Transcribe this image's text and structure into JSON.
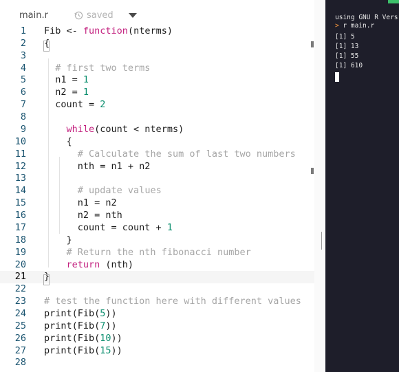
{
  "tab": {
    "filename": "main.r",
    "status": "saved"
  },
  "editor": {
    "current_line": 21,
    "lines": [
      {
        "n": "1",
        "tokens": [
          {
            "t": "Fib <- "
          },
          {
            "t": "function",
            "c": "kw"
          },
          {
            "t": "(nterms)"
          }
        ]
      },
      {
        "n": "2",
        "tokens": [
          {
            "t": "{"
          }
        ]
      },
      {
        "n": "3",
        "tokens": []
      },
      {
        "n": "4",
        "tokens": [
          {
            "t": "  "
          },
          {
            "t": "# first two terms",
            "c": "cm"
          }
        ]
      },
      {
        "n": "5",
        "tokens": [
          {
            "t": "  n1 = "
          },
          {
            "t": "1",
            "c": "num"
          }
        ]
      },
      {
        "n": "6",
        "tokens": [
          {
            "t": "  n2 = "
          },
          {
            "t": "1",
            "c": "num"
          }
        ]
      },
      {
        "n": "7",
        "tokens": [
          {
            "t": "  count = "
          },
          {
            "t": "2",
            "c": "num"
          }
        ]
      },
      {
        "n": "8",
        "tokens": []
      },
      {
        "n": "9",
        "tokens": [
          {
            "t": "    "
          },
          {
            "t": "while",
            "c": "kw"
          },
          {
            "t": "(count < nterms)"
          }
        ]
      },
      {
        "n": "10",
        "tokens": [
          {
            "t": "    {"
          }
        ]
      },
      {
        "n": "11",
        "tokens": [
          {
            "t": "      "
          },
          {
            "t": "# Calculate the sum of last two numbers",
            "c": "cm"
          }
        ]
      },
      {
        "n": "12",
        "tokens": [
          {
            "t": "      nth = n1 + n2"
          }
        ]
      },
      {
        "n": "13",
        "tokens": []
      },
      {
        "n": "14",
        "tokens": [
          {
            "t": "      "
          },
          {
            "t": "# update values",
            "c": "cm"
          }
        ]
      },
      {
        "n": "15",
        "tokens": [
          {
            "t": "      n1 = n2"
          }
        ]
      },
      {
        "n": "16",
        "tokens": [
          {
            "t": "      n2 = nth"
          }
        ]
      },
      {
        "n": "17",
        "tokens": [
          {
            "t": "      count = count + "
          },
          {
            "t": "1",
            "c": "num"
          }
        ]
      },
      {
        "n": "18",
        "tokens": [
          {
            "t": "    }"
          }
        ]
      },
      {
        "n": "19",
        "tokens": [
          {
            "t": "    "
          },
          {
            "t": "# Return the nth fibonacci number",
            "c": "cm"
          }
        ]
      },
      {
        "n": "20",
        "tokens": [
          {
            "t": "    "
          },
          {
            "t": "return",
            "c": "kw"
          },
          {
            "t": " (nth)"
          }
        ]
      },
      {
        "n": "21",
        "tokens": [
          {
            "t": "}"
          }
        ]
      },
      {
        "n": "22",
        "tokens": []
      },
      {
        "n": "23",
        "tokens": [
          {
            "t": "# test the function here with different values",
            "c": "cm"
          }
        ]
      },
      {
        "n": "24",
        "tokens": [
          {
            "t": "print(Fib("
          },
          {
            "t": "5",
            "c": "num"
          },
          {
            "t": "))"
          }
        ]
      },
      {
        "n": "25",
        "tokens": [
          {
            "t": "print(Fib("
          },
          {
            "t": "7",
            "c": "num"
          },
          {
            "t": "))"
          }
        ]
      },
      {
        "n": "26",
        "tokens": [
          {
            "t": "print(Fib("
          },
          {
            "t": "10",
            "c": "num"
          },
          {
            "t": "))"
          }
        ]
      },
      {
        "n": "27",
        "tokens": [
          {
            "t": "print(Fib("
          },
          {
            "t": "15",
            "c": "num"
          },
          {
            "t": "))"
          }
        ]
      },
      {
        "n": "28",
        "tokens": []
      }
    ]
  },
  "console": {
    "header": "using GNU R Vers",
    "prompt_symbol": ">",
    "command": " r main.r",
    "outputs": [
      "[1] 5",
      "[1] 13",
      "[1] 55",
      "[1] 610"
    ]
  },
  "colors": {
    "keyword": "#c3217f",
    "number": "#0c8f6f",
    "comment": "#a6a6a6",
    "line_number": "#19536f",
    "console_bg": "#1e1e2a",
    "prompt": "#ff9a3d"
  },
  "icons": {
    "status": "history-icon",
    "tab_menu": "caret-down-icon"
  }
}
